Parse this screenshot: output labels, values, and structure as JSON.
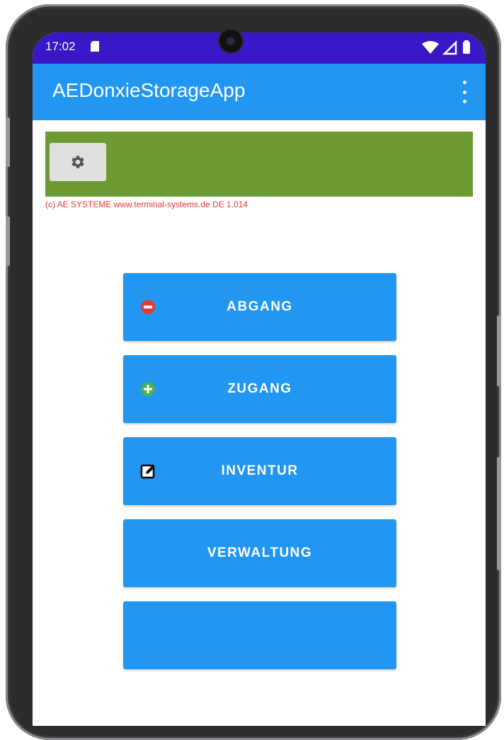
{
  "status_bar": {
    "time": "17:02",
    "icons": [
      "sd-card-icon",
      "wifi-icon",
      "signal-icon",
      "battery-icon"
    ]
  },
  "app_bar": {
    "title": "AEDonxieStorageApp",
    "overflow_icon": "more-vertical-icon"
  },
  "settings_panel": {
    "settings_icon": "gear-icon",
    "copyright": "(c) AE SYSTEME www.terminal-systems.de DE 1.014"
  },
  "menu": {
    "items": [
      {
        "label": "ABGANG",
        "icon": "minus-circle-icon"
      },
      {
        "label": "ZUGANG",
        "icon": "plus-circle-icon"
      },
      {
        "label": "INVENTUR",
        "icon": "edit-icon"
      },
      {
        "label": "VERWALTUNG",
        "icon": ""
      },
      {
        "label": "",
        "icon": ""
      }
    ]
  },
  "colors": {
    "status_bar": "#3a17c6",
    "app_bar": "#2196f3",
    "button": "#2196f3",
    "panel": "#6d9a32",
    "copyright_text": "#e53935"
  }
}
